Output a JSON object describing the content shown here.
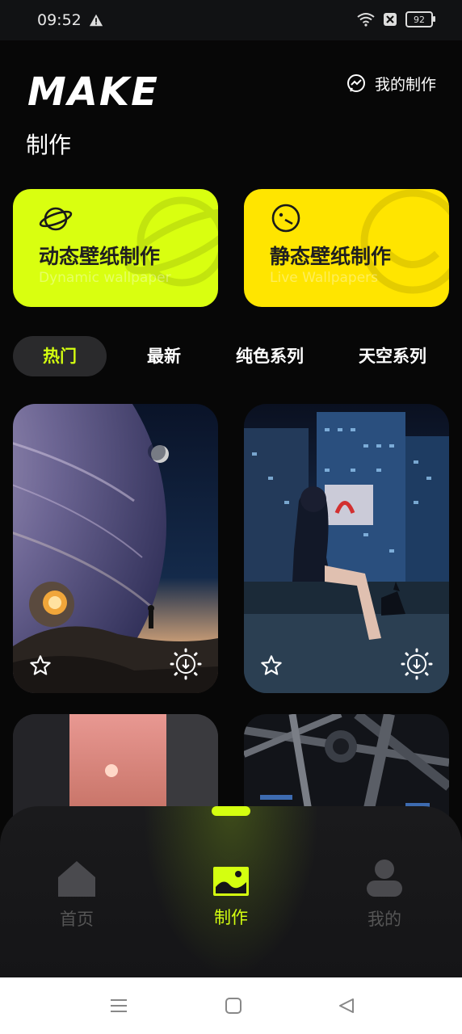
{
  "status": {
    "time": "09:52",
    "battery": "92"
  },
  "header": {
    "logo": "MAKE",
    "subtitle": "制作",
    "my_make_label": "我的制作"
  },
  "cards": [
    {
      "title": "动态壁纸制作",
      "subtitle": "Dynamic wallpaper",
      "color": "#d9ff10",
      "icon": "planet-icon"
    },
    {
      "title": "静态壁纸制作",
      "subtitle": "Live Wallpapers",
      "color": "#ffe500",
      "icon": "face-icon"
    }
  ],
  "tabs": [
    {
      "label": "热门",
      "active": true
    },
    {
      "label": "最新",
      "active": false
    },
    {
      "label": "纯色系列",
      "active": false
    },
    {
      "label": "天空系列",
      "active": false
    }
  ],
  "grid": [
    {
      "name": "wallpaper-planet",
      "icons": [
        "star-icon",
        "download-icon"
      ]
    },
    {
      "name": "wallpaper-city-girl",
      "icons": [
        "star-icon",
        "download-icon"
      ]
    },
    {
      "name": "wallpaper-sunset"
    },
    {
      "name": "wallpaper-machinery"
    }
  ],
  "nav": [
    {
      "label": "首页",
      "icon": "home-icon",
      "active": false
    },
    {
      "label": "制作",
      "icon": "image-icon",
      "active": true
    },
    {
      "label": "我的",
      "icon": "user-icon",
      "active": false
    }
  ],
  "accent_color": "#d4ff10"
}
